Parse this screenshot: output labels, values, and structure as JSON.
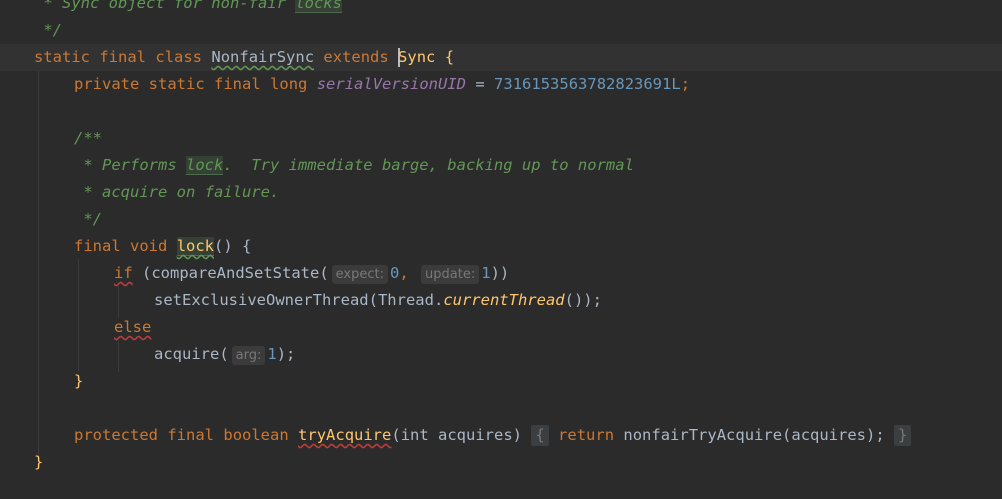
{
  "tokens": {
    "sync_object_comment": " * Sync object for non-fair ",
    "locks": "locks",
    "comment_close": " */",
    "static": "static",
    "final": "final",
    "class": "class",
    "class_name": "NonfairSync",
    "extends": "extends",
    "parent_s": "S",
    "parent_rest": "ync",
    "open_brace": "{",
    "close_brace": "}",
    "private": "private",
    "long": "long",
    "serial_field": "serialVersionUID",
    "equals": "=",
    "serial_value": "7316153563782823691L",
    "semicolon": ";",
    "javadoc_open": "/**",
    "javadoc_performs": " * Performs ",
    "lock_word": "lock",
    "javadoc_rest1": ".  Try immediate barge, backing up to normal",
    "javadoc_line2": " * acquire on failure.",
    "javadoc_close": " */",
    "void": "void",
    "lock_method": "lock",
    "parens_open_brace": "() {",
    "if": "if",
    "open_paren": " (",
    "cas_method": "compareAndSetState(",
    "hint_expect": "expect:",
    "zero": "0",
    "comma": ",",
    "hint_update": "update:",
    "one": "1",
    "close_parens2": "))",
    "set_owner": "setExclusiveOwnerThread(",
    "thread_class": "Thread",
    "dot": ".",
    "current_thread": "currentThread",
    "close_call": "());",
    "else": "else",
    "acquire_call": "acquire(",
    "hint_arg": "arg:",
    "close_paren_semi": ");",
    "protected": "protected",
    "boolean": "boolean",
    "try_acquire": "tryAcquire",
    "int_acquires": "(int acquires)",
    "fold_open": "{",
    "return": "return",
    "nonfair_call": "nonfairTryAcquire(acquires);",
    "fold_close": "}"
  },
  "colors": {
    "background": "#2b2b2b",
    "keyword": "#cc7832",
    "comment": "#629755",
    "number": "#6897bb",
    "field": "#9876aa",
    "method": "#ffc66d",
    "text": "#a9b7c6"
  }
}
